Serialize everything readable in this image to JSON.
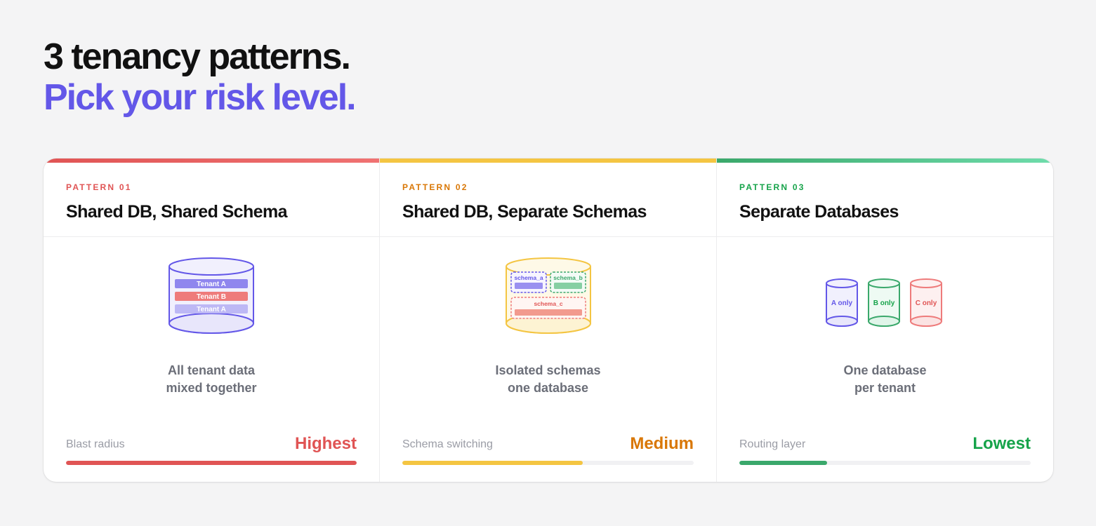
{
  "headline": {
    "line1": "3 tenancy patterns.",
    "line2": "Pick your risk level."
  },
  "patterns": [
    {
      "tag": "PATTERN 01",
      "title": "Shared DB, Shared Schema",
      "caption_line1": "All tenant data",
      "caption_line2": "mixed together",
      "metric_label": "Blast radius",
      "metric_value": "Highest",
      "metric_level": 1.0,
      "accent": "#e05454",
      "rows": [
        "Tenant A",
        "Tenant B",
        "Tenant A"
      ]
    },
    {
      "tag": "PATTERN 02",
      "title": "Shared DB, Separate Schemas",
      "caption_line1": "Isolated schemas",
      "caption_line2": "one database",
      "metric_label": "Schema switching",
      "metric_value": "Medium",
      "metric_level": 0.62,
      "accent": "#d97706",
      "schemas": [
        "schema_a",
        "schema_b",
        "schema_c"
      ]
    },
    {
      "tag": "PATTERN 03",
      "title": "Separate Databases",
      "caption_line1": "One database",
      "caption_line2": "per tenant",
      "metric_label": "Routing layer",
      "metric_value": "Lowest",
      "metric_level": 0.3,
      "accent": "#16a34a",
      "dbs": [
        "A only",
        "B only",
        "C only"
      ]
    }
  ],
  "colors": {
    "purple": "#6357e8",
    "red": "#e05454",
    "yellow": "#f4c542",
    "green": "#3aa86b"
  }
}
